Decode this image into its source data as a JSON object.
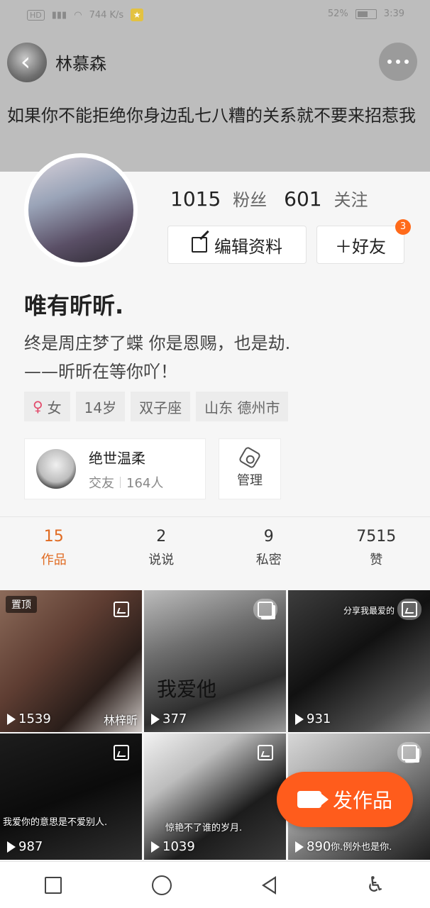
{
  "status_bar": {
    "left_text": "HD 4G",
    "speed": "744 K/s",
    "right_battery": "52%",
    "time": "3:39"
  },
  "header": {
    "username": "林慕森",
    "top_text": "如果你不能拒绝你身边乱七八糟的关系就不要来招惹我"
  },
  "profile": {
    "fans_count": "1015",
    "fans_label": "粉丝",
    "follow_count": "601",
    "follow_label": "关注",
    "edit_label": "编辑资料",
    "friend_label": "＋好友",
    "friend_badge": "3",
    "nickname": "唯有昕昕.",
    "bio_line1": "终是周庄梦了蝶 你是恩赐，也是劫.",
    "bio_line2": "——昕昕在等你吖！",
    "tags": [
      {
        "icon": "female",
        "label": "女"
      },
      {
        "label": "14岁"
      },
      {
        "label": "双子座"
      },
      {
        "label": "山东 德州市"
      }
    ],
    "group": {
      "name": "绝世温柔",
      "type": "交友",
      "members": "164人"
    },
    "manage_label": "管理"
  },
  "tabs": [
    {
      "count": "15",
      "name": "作品",
      "active": true
    },
    {
      "count": "2",
      "name": "说说"
    },
    {
      "count": "9",
      "name": "私密"
    },
    {
      "count": "7515",
      "name": "赞"
    }
  ],
  "grid": [
    {
      "views": "1539",
      "pinned": "置顶",
      "overlay": "林梓昕"
    },
    {
      "views": "377",
      "overlay": "我爱他"
    },
    {
      "views": "931",
      "overlay": "分享我最爱的"
    },
    {
      "views": "987",
      "overlay": "我爱你的意思是不爱别人."
    },
    {
      "views": "1039",
      "overlay": "惊艳不了谁的岁月."
    },
    {
      "views": "890",
      "overlay": "你.例外也是你."
    }
  ],
  "publish_label": "发作品"
}
